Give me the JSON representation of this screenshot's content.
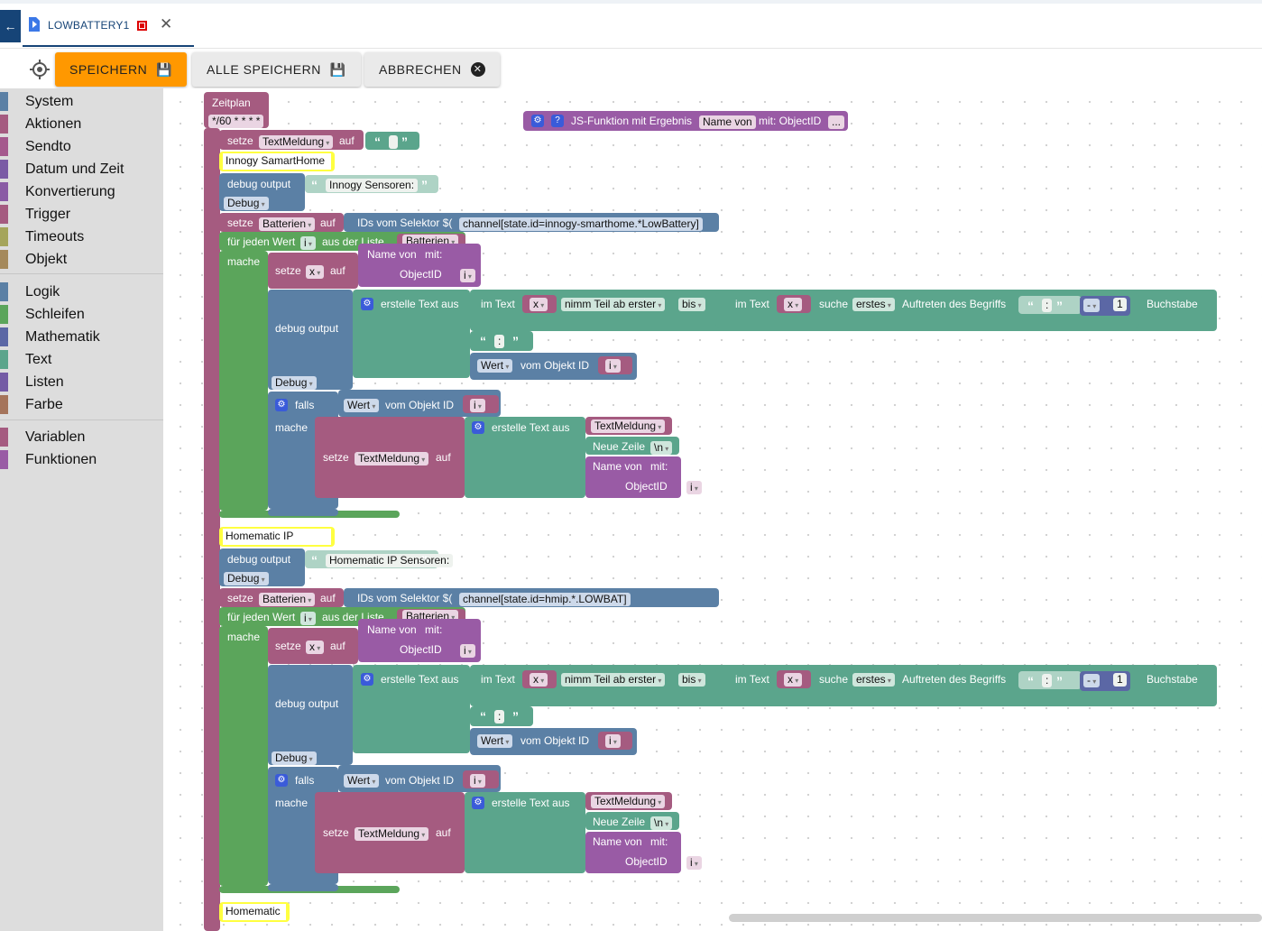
{
  "tab": {
    "title": "LOWBATTERY1"
  },
  "toolbar": {
    "save": "SPEICHERN",
    "save_all": "ALLE SPEICHERN",
    "cancel": "ABBRECHEN"
  },
  "sidebar": {
    "items": [
      "System",
      "Aktionen",
      "Sendto",
      "Datum und Zeit",
      "Konvertierung",
      "Trigger",
      "Timeouts",
      "Objekt",
      "Logik",
      "Schleifen",
      "Mathematik",
      "Text",
      "Listen",
      "Farbe",
      "Variablen",
      "Funktionen"
    ],
    "colors": [
      "#5b80a5",
      "#a55b80",
      "#a5598d",
      "#7a5ba5",
      "#8a5ba5",
      "#a55b80",
      "#a5a55b",
      "#a5895b",
      "#5b80a5",
      "#5ba55b",
      "#5b67a5",
      "#5ba58c",
      "#745ba5",
      "#a5745b",
      "#a55b80",
      "#995ba5"
    ]
  },
  "colors": {
    "event": "#a55b80",
    "var": "#a55b80",
    "debug": "#5b80a5",
    "text": "#5ba58c",
    "loop": "#5ba55b",
    "list": "#745ba5",
    "func": "#995ba5",
    "highlight": "#ffff40",
    "accent": "#ff9800",
    "brand": "#164477"
  },
  "blocks": {
    "schedule_label": "Zeitplan",
    "schedule_cron": "*/60 * * * *",
    "js_func": "JS-Funktion mit Ergebnis",
    "js_name": "Name von",
    "js_mit": "mit: ObjectID",
    "js_more": "...",
    "setze": "setze",
    "auf": "auf",
    "var_textmeldung": "TextMeldung",
    "var_batterien": "Batterien",
    "var_x": "x",
    "var_i": "i",
    "debug_output": "debug output",
    "debug_level": "Debug",
    "ids_selector": "IDs vom Selektor $(",
    "paren_close": ")",
    "for_each": "für jeden Wert",
    "from_list": "aus der Liste",
    "mache": "mache",
    "name_von": "Name von",
    "mit": "mit:",
    "objectid": "ObjectID",
    "create_text": "erstelle Text aus",
    "im_text": "im Text",
    "nimm_teil": "nimm Teil ab erster",
    "bis": "bis",
    "suche": "suche",
    "erstes": "erstes",
    "auftreten": "Auftreten des Begriffs",
    "colon": ":",
    "minus": "-",
    "one": "1",
    "buchstabe": "Buchstabe",
    "wert": "Wert",
    "vom_objekt": "vom Objekt ID",
    "falls": "falls",
    "neue_zeile": "Neue Zeile",
    "newline": "\\n"
  },
  "sections": [
    {
      "comment": "Innogy SamartHome",
      "debug_text": "Innogy Sensoren:",
      "selector": "channel[state.id=innogy-smarthome.*LowBattery]"
    },
    {
      "comment": "Homematic IP",
      "debug_text": "Homematic IP Sensoren:",
      "selector": "channel[state.id=hmip.*.LOWBAT]"
    },
    {
      "comment": "Homematic"
    }
  ]
}
